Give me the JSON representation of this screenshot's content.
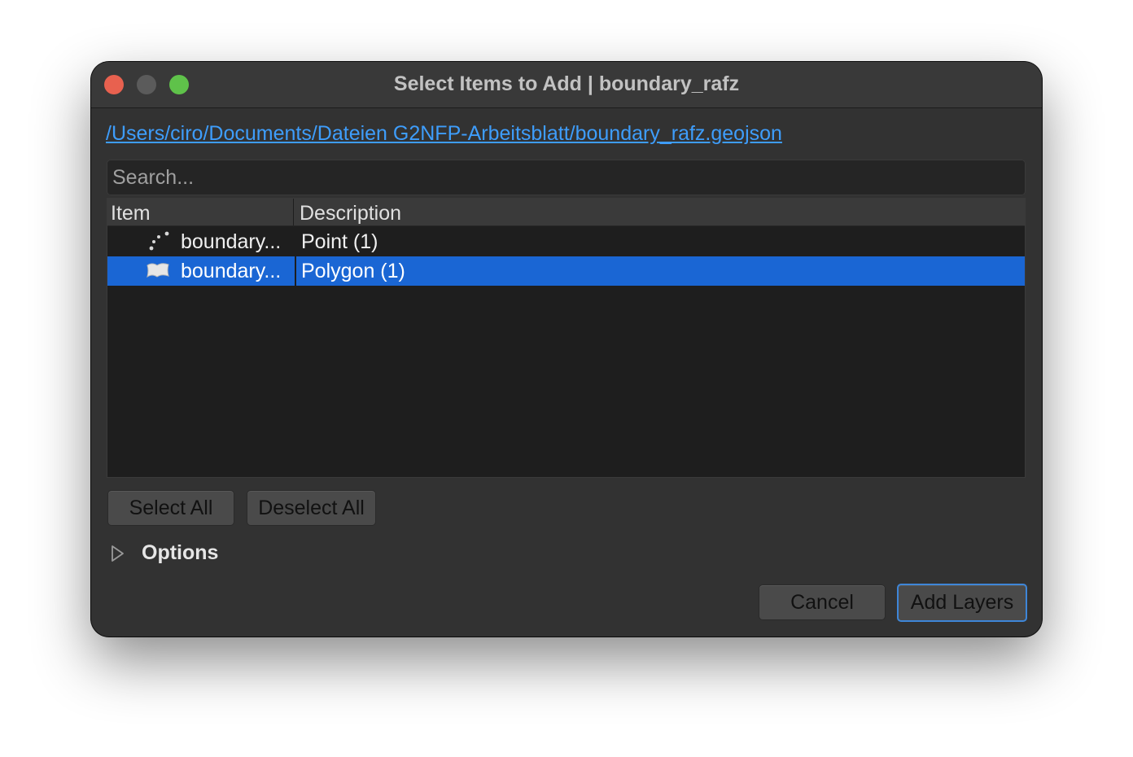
{
  "window": {
    "title": "Select Items to Add | boundary_rafz"
  },
  "source_path": "/Users/ciro/Documents/Dateien G2NFP-Arbeitsblatt/boundary_rafz.geojson",
  "search": {
    "placeholder": "Search..."
  },
  "table": {
    "columns": [
      "Item",
      "Description"
    ],
    "rows": [
      {
        "icon": "point-layer-icon",
        "item": "boundary...",
        "description": "Point (1)",
        "selected": false
      },
      {
        "icon": "polygon-layer-icon",
        "item": "boundary...",
        "description": "Polygon (1)",
        "selected": true
      }
    ]
  },
  "buttons": {
    "select_all": "Select All",
    "deselect_all": "Deselect All",
    "cancel": "Cancel",
    "add_layers": "Add Layers"
  },
  "options": {
    "label": "Options",
    "icon": "disclosure-triangle-icon",
    "expanded": false
  },
  "colors": {
    "selection": "#1a66d4",
    "link": "#3e9dfb",
    "close": "#e8614f",
    "maximize": "#5fc24a"
  }
}
